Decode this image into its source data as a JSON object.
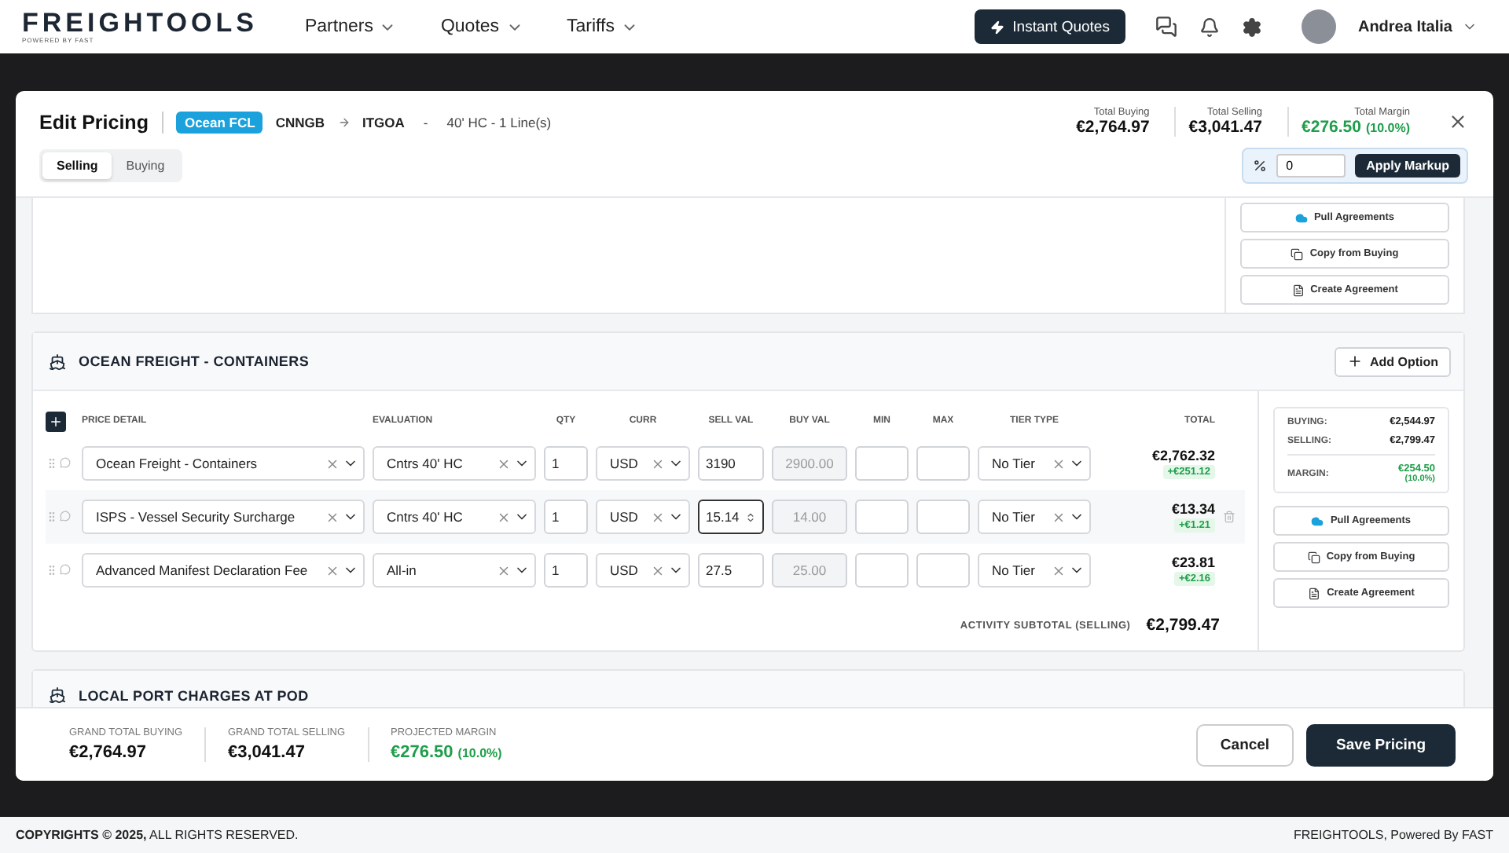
{
  "nav": {
    "logo": "FREIGHTOOLS",
    "logo_sub": "POWERED BY FAST",
    "menus": [
      {
        "label": "Partners"
      },
      {
        "label": "Quotes"
      },
      {
        "label": "Tariffs"
      }
    ],
    "instant_quotes": "Instant Quotes",
    "user": "Andrea Italia"
  },
  "modal": {
    "title": "Edit Pricing",
    "mode": "Ocean FCL",
    "origin": "CNNGB",
    "destination": "ITGOA",
    "separator": "-",
    "equipment": "40' HC - 1 Line(s)",
    "totals": [
      {
        "label": "Total Buying",
        "value": "€2,764.97",
        "kind": "plain"
      },
      {
        "label": "Total Selling",
        "value": "€3,041.47",
        "kind": "plain"
      },
      {
        "label": "Total Margin",
        "value": "€276.50",
        "pct": "(10.0%)",
        "kind": "margin"
      }
    ],
    "tabs": [
      {
        "label": "Selling",
        "selected": true
      },
      {
        "label": "Buying",
        "selected": false
      }
    ],
    "markup": {
      "value": "0",
      "button": "Apply Markup"
    },
    "top_actions": [
      "Pull Agreements",
      "Copy from Buying",
      "Create Agreement"
    ],
    "section": {
      "title": "OCEAN FREIGHT - CONTAINERS",
      "add_option": "Add Option",
      "columns": [
        "PRICE DETAIL",
        "EVALUATION",
        "QTY",
        "CURR",
        "SELL VAL",
        "BUY VAL",
        "MIN",
        "MAX",
        "TIER TYPE",
        "TOTAL"
      ],
      "rows": [
        {
          "detail": "Ocean Freight - Containers",
          "evaluation": "Cntrs 40' HC",
          "qty": "1",
          "curr": "USD",
          "sell": "3190",
          "buy": "2900.00",
          "tier": "No Tier",
          "total": "€2,762.32",
          "margin": "+€251.12",
          "focused": false,
          "hovered": false
        },
        {
          "detail": "ISPS - Vessel Security Surcharge",
          "evaluation": "Cntrs 40' HC",
          "qty": "1",
          "curr": "USD",
          "sell": "15.14",
          "buy": "14.00",
          "tier": "No Tier",
          "total": "€13.34",
          "margin": "+€1.21",
          "focused": true,
          "hovered": true
        },
        {
          "detail": "Advanced Manifest Declaration Fee",
          "evaluation": "All-in",
          "qty": "1",
          "curr": "USD",
          "sell": "27.5",
          "buy": "25.00",
          "tier": "No Tier",
          "total": "€23.81",
          "margin": "+€2.16",
          "focused": false,
          "hovered": false
        }
      ],
      "subtotal_label": "ACTIVITY SUBTOTAL (SELLING)",
      "subtotal": "€2,799.47",
      "summary": {
        "buying_label": "BUYING:",
        "buying": "€2,544.97",
        "selling_label": "SELLING:",
        "selling": "€2,799.47",
        "margin_label": "MARGIN:",
        "margin": "€254.50",
        "margin_pct": "(10.0%)"
      },
      "actions": [
        "Pull Agreements",
        "Copy from Buying",
        "Create Agreement"
      ]
    },
    "next_section": "LOCAL PORT CHARGES AT POD",
    "footer": {
      "totals": [
        {
          "label": "GRAND TOTAL BUYING",
          "value": "€2,764.97",
          "kind": "plain"
        },
        {
          "label": "GRAND TOTAL SELLING",
          "value": "€3,041.47",
          "kind": "plain"
        },
        {
          "label": "PROJECTED MARGIN",
          "value": "€276.50",
          "pct": "(10.0%)",
          "kind": "margin"
        }
      ],
      "cancel": "Cancel",
      "save": "Save Pricing"
    }
  },
  "page_footer": {
    "left": "**COPYRIGHTS © 2025,** ALL RIGHTS RESERVED.",
    "right": "FREIGHTOOLS, Powered By FAST"
  }
}
